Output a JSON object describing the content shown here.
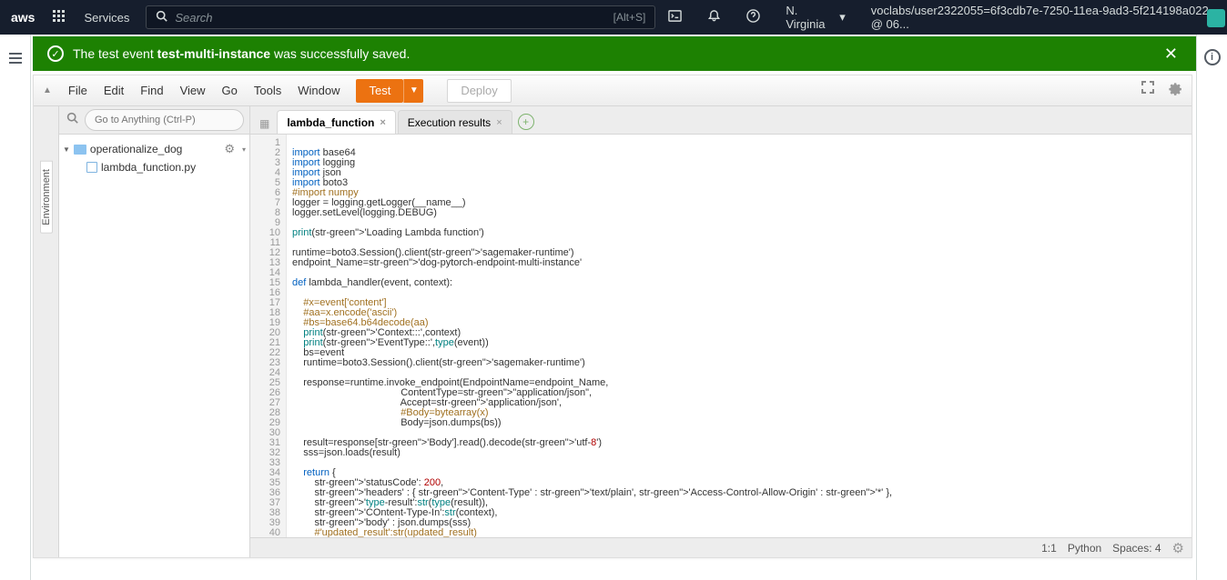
{
  "topnav": {
    "services": "Services",
    "search_placeholder": "Search",
    "search_hint": "[Alt+S]",
    "region": "N. Virginia",
    "user": "voclabs/user2322055=6f3cdb7e-7250-11ea-9ad3-5f214198a022 @ 06..."
  },
  "banner": {
    "prefix": "The test event ",
    "name": "test-multi-instance",
    "suffix": " was successfully saved."
  },
  "menubar": {
    "items": [
      "File",
      "Edit",
      "Find",
      "View",
      "Go",
      "Tools",
      "Window"
    ],
    "test": "Test",
    "deploy": "Deploy"
  },
  "left_rail": {
    "env": "Environment"
  },
  "goto": {
    "placeholder": "Go to Anything (Ctrl-P)"
  },
  "tree": {
    "folder": "operationalize_dog",
    "file": "lambda_function.py"
  },
  "tabs": {
    "t1": "lambda_function",
    "t2": "Execution results"
  },
  "status": {
    "pos": "1:1",
    "lang": "Python",
    "spaces": "Spaces: 4"
  },
  "code_lines": [
    "",
    "import base64",
    "import logging",
    "import json",
    "import boto3",
    "#import numpy",
    "logger = logging.getLogger(__name__)",
    "logger.setLevel(logging.DEBUG)",
    "",
    "print('Loading Lambda function')",
    "",
    "runtime=boto3.Session().client('sagemaker-runtime')",
    "endpoint_Name='dog-pytorch-endpoint-multi-instance'",
    "",
    "def lambda_handler(event, context):",
    "",
    "    #x=event['content']",
    "    #aa=x.encode('ascii')",
    "    #bs=base64.b64decode(aa)",
    "    print('Context:::',context)",
    "    print('EventType::',type(event))",
    "    bs=event",
    "    runtime=boto3.Session().client('sagemaker-runtime')",
    "",
    "    response=runtime.invoke_endpoint(EndpointName=endpoint_Name,",
    "                                       ContentType=\"application/json\",",
    "                                       Accept='application/json',",
    "                                       #Body=bytearray(x)",
    "                                       Body=json.dumps(bs))",
    "",
    "    result=response['Body'].read().decode('utf-8')",
    "    sss=json.loads(result)",
    "",
    "    return {",
    "        'statusCode': 200,",
    "        'headers' : { 'Content-Type' : 'text/plain', 'Access-Control-Allow-Origin' : '*' },",
    "        'type-result':str(type(result)),",
    "        'COntent-Type-In':str(context),",
    "        'body' : json.dumps(sss)",
    "        #'updated_result':str(updated_result)",
    "",
    "        }"
  ]
}
